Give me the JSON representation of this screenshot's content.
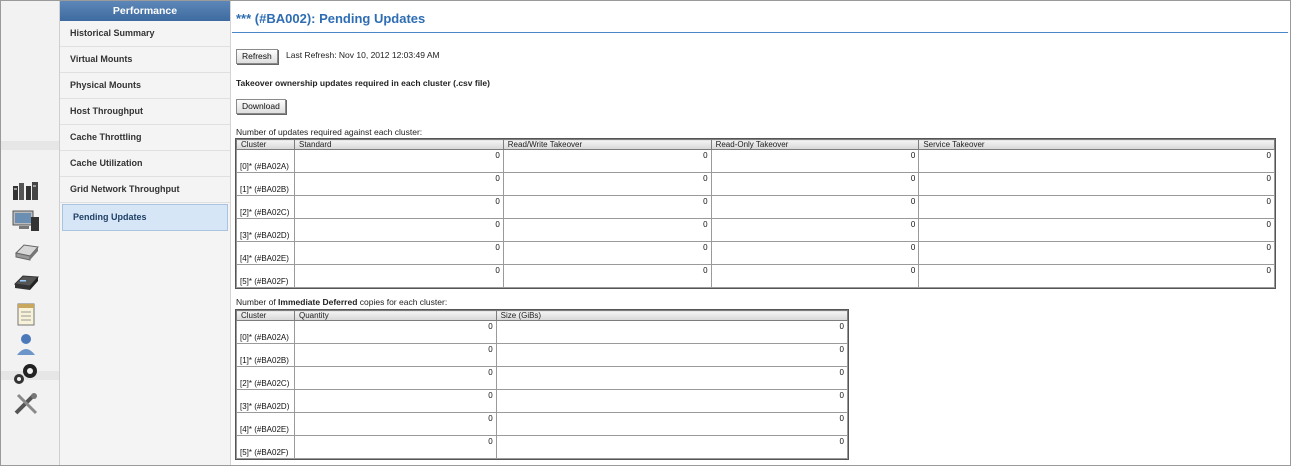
{
  "nav": {
    "header": "Performance",
    "items": [
      {
        "label": "Historical Summary"
      },
      {
        "label": "Virtual Mounts"
      },
      {
        "label": "Physical Mounts"
      },
      {
        "label": "Host Throughput"
      },
      {
        "label": "Cache Throttling"
      },
      {
        "label": "Cache Utilization"
      },
      {
        "label": "Grid Network Throughput"
      },
      {
        "label": "Pending Updates",
        "active": true
      }
    ]
  },
  "rail_icons": [
    "cluster-icon",
    "monitor-icon",
    "drive-icon",
    "tape-drive-icon",
    "notepad-icon",
    "user-icon",
    "gears-icon",
    "tools-icon"
  ],
  "page": {
    "title": "*** (#BA002): Pending Updates",
    "refresh_label": "Refresh",
    "last_refresh": "Last Refresh:  Nov 10, 2012 12:03:49 AM",
    "takeover_heading": "Takeover ownership updates required in each cluster (.csv file)",
    "download_label": "Download",
    "updates_caption": "Number of updates required against each cluster:",
    "deferred_caption_pre": "Number of ",
    "deferred_caption_bold": "Immediate Deferred",
    "deferred_caption_post": " copies for each cluster:"
  },
  "updates_table": {
    "columns": [
      "Cluster",
      "Standard",
      "Read/Write Takeover",
      "Read-Only Takeover",
      "Service Takeover"
    ],
    "rows": [
      {
        "cluster": "[0]* (#BA02A)",
        "values": [
          "0",
          "0",
          "0",
          "0"
        ]
      },
      {
        "cluster": "[1]* (#BA02B)",
        "values": [
          "0",
          "0",
          "0",
          "0"
        ]
      },
      {
        "cluster": "[2]* (#BA02C)",
        "values": [
          "0",
          "0",
          "0",
          "0"
        ]
      },
      {
        "cluster": "[3]* (#BA02D)",
        "values": [
          "0",
          "0",
          "0",
          "0"
        ]
      },
      {
        "cluster": "[4]* (#BA02E)",
        "values": [
          "0",
          "0",
          "0",
          "0"
        ]
      },
      {
        "cluster": "[5]* (#BA02F)",
        "values": [
          "0",
          "0",
          "0",
          "0"
        ]
      }
    ]
  },
  "deferred_table": {
    "columns": [
      "Cluster",
      "Quantity",
      "Size (GiBs)"
    ],
    "rows": [
      {
        "cluster": "[0]* (#BA02A)",
        "values": [
          "0",
          "0"
        ]
      },
      {
        "cluster": "[1]* (#BA02B)",
        "values": [
          "0",
          "0"
        ]
      },
      {
        "cluster": "[2]* (#BA02C)",
        "values": [
          "0",
          "0"
        ]
      },
      {
        "cluster": "[3]* (#BA02D)",
        "values": [
          "0",
          "0"
        ]
      },
      {
        "cluster": "[4]* (#BA02E)",
        "values": [
          "0",
          "0"
        ]
      },
      {
        "cluster": "[5]* (#BA02F)",
        "values": [
          "0",
          "0"
        ]
      }
    ]
  }
}
